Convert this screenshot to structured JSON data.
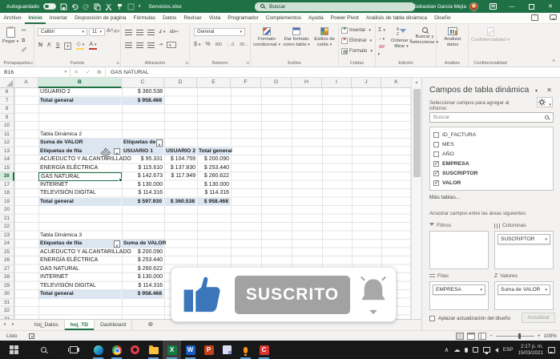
{
  "title_bar": {
    "autosave": "Autoguardado",
    "filename": "Servicios.xlsx",
    "search": "Buscar",
    "user": "Sebastian García Mejía"
  },
  "menu": {
    "items": [
      "Archivo",
      "Inicio",
      "Insertar",
      "Disposición de página",
      "Fórmulas",
      "Datos",
      "Revisar",
      "Vista",
      "Programador",
      "Complementos",
      "Ayuda",
      "Power Pivot",
      "Análisis de tabla dinámica",
      "Diseño"
    ]
  },
  "ribbon": {
    "paste": "Pegar",
    "font_name": "Calibri",
    "font_size": "11",
    "number_format": "General",
    "conditional": "Formato condicional",
    "format_table": "Dar formato como tabla",
    "cell_styles": "Estilos de celda",
    "insert": "Insertar",
    "delete": "Eliminar",
    "format": "Formato",
    "sort_filter": "Ordenar y filtrar",
    "find_select": "Buscar y seleccionar",
    "analyze_data": "Analizar datos",
    "confidentiality": "Confidencialidad",
    "groups": {
      "clipboard": "Portapapeles",
      "font": "Fuente",
      "alignment": "Alineación",
      "number": "Número",
      "styles": "Estilos",
      "cells": "Celdas",
      "editing": "Edición",
      "analysis": "Análisis",
      "confidentiality": "Confidencialidad"
    }
  },
  "formula_bar": {
    "name_box": "B16",
    "fx": "fx",
    "value": "GAS NATURAL"
  },
  "sheet": {
    "columns": [
      "A",
      "B",
      "C",
      "D",
      "E",
      "F",
      "G",
      "H",
      "I",
      "J",
      "K"
    ],
    "rows": [
      {
        "n": "6",
        "B": "USUARIO 2",
        "C": "$ 360.538"
      },
      {
        "n": "7",
        "B": "Total general",
        "C": "$ 958.468"
      },
      {
        "n": "8"
      },
      {
        "n": "9"
      },
      {
        "n": "10"
      },
      {
        "n": "11",
        "B": "Tabla Dinámica 2"
      },
      {
        "n": "12",
        "B": "Suma de VALOR",
        "C": "Etiquetas de c"
      },
      {
        "n": "13",
        "B": "Etiquetas de fila",
        "C": "USUARIO 1",
        "D": "USUARIO 2",
        "E": "Total general"
      },
      {
        "n": "14",
        "B": "ACUEDUCTO Y ALCANTARILLADO",
        "C": "$ 95.331",
        "D": "$ 104.759",
        "E": "$ 200.090"
      },
      {
        "n": "15",
        "B": "ENERGÍA ELÉCTRICA",
        "C": "$ 115.610",
        "D": "$ 137.830",
        "E": "$ 253.440"
      },
      {
        "n": "16",
        "B": "GAS NATURAL",
        "C": "$ 142.673",
        "D": "$ 117.949",
        "E": "$ 260.622"
      },
      {
        "n": "17",
        "B": "INTERNET",
        "C": "$ 130.000",
        "E": "$ 130.000"
      },
      {
        "n": "18",
        "B": "TELEVISIÓN DIGITAL",
        "C": "$ 114.316",
        "E": "$ 114.316"
      },
      {
        "n": "19",
        "B": "Total general",
        "C": "$ 597.930",
        "D": "$ 360.538",
        "E": "$ 958.468"
      },
      {
        "n": "20"
      },
      {
        "n": "21"
      },
      {
        "n": "22"
      },
      {
        "n": "23",
        "B": "Tabla Dinámica 3"
      },
      {
        "n": "24",
        "B": "Etiquetas de fila",
        "C": "Suma de VALOR"
      },
      {
        "n": "25",
        "B": "ACUEDUCTO Y ALCANTARILLADO",
        "C": "$ 200.090"
      },
      {
        "n": "26",
        "B": "ENERGÍA ELÉCTRICA",
        "C": "$ 253.440"
      },
      {
        "n": "27",
        "B": "GAS NATURAL",
        "C": "$ 260.622"
      },
      {
        "n": "28",
        "B": "INTERNET",
        "C": "$ 130.000"
      },
      {
        "n": "29",
        "B": "TELEVISIÓN DIGITAL",
        "C": "$ 114.316"
      },
      {
        "n": "30",
        "B": "Total general",
        "C": "$ 958.468"
      },
      {
        "n": "31"
      },
      {
        "n": "32"
      },
      {
        "n": "33"
      }
    ]
  },
  "sheet_tabs": {
    "items": [
      "hoj_Datos",
      "hoj_TD",
      "Dashboard"
    ]
  },
  "status_bar": {
    "ready": "Listo",
    "zoom": "100%"
  },
  "panel": {
    "title": "Campos de tabla dinámica",
    "subtitle": "Seleccionar campos para agregar al informe:",
    "search": "Buscar",
    "fields": [
      {
        "label": "ID_FACTURA",
        "checked": false
      },
      {
        "label": "MES",
        "checked": false
      },
      {
        "label": "AÑO",
        "checked": false
      },
      {
        "label": "EMPRESA",
        "checked": true
      },
      {
        "label": "SUSCRIPTOR",
        "checked": true
      },
      {
        "label": "VALOR",
        "checked": true
      }
    ],
    "more_tables": "Más tablas...",
    "drag_hint": "Arrastrar campos entre las áreas siguientes:",
    "areas": {
      "filters_label": "Filtros",
      "columns_label": "Columnas",
      "rows_label": "Filas",
      "values_label": "Valores",
      "columns_field": "SUSCRIPTOR",
      "rows_field": "EMPRESA",
      "values_field": "Suma de VALOR"
    },
    "defer_label": "Aplazar actualización del diseño",
    "update_label": "Actualizar"
  },
  "overlay": {
    "subscribe": "SUSCRITO"
  },
  "taskbar": {
    "lang": "ESP",
    "time": "2:17 p. m.",
    "date": "15/03/2021"
  }
}
